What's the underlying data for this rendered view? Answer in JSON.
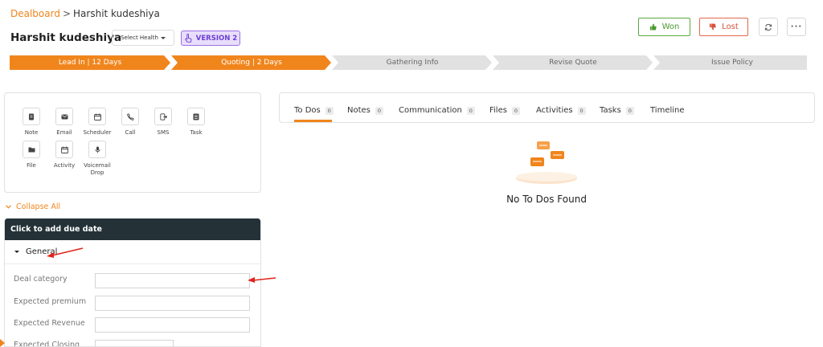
{
  "breadcrumb": {
    "root": "Dealboard",
    "separator": ">",
    "current": "Harshit kudeshiya"
  },
  "header": {
    "title": "Harshit kudeshiya",
    "health_select": "Select Health",
    "version": "VERSION 2",
    "won_label": "Won",
    "lost_label": "Lost"
  },
  "pipeline": {
    "stages": [
      {
        "label": "Lead In | 12 Days",
        "state": "active"
      },
      {
        "label": "Quoting | 2 Days",
        "state": "active"
      },
      {
        "label": "Gathering Info",
        "state": "inactive"
      },
      {
        "label": "Revise Quote",
        "state": "inactive"
      },
      {
        "label": "Issue Policy",
        "state": "inactive"
      }
    ],
    "active_color": "#f0851c",
    "inactive_color": "#e1e1e1"
  },
  "activities": [
    {
      "label": "Note",
      "icon": "note-icon"
    },
    {
      "label": "Email",
      "icon": "email-icon"
    },
    {
      "label": "Scheduler",
      "icon": "calendar-icon"
    },
    {
      "label": "Call",
      "icon": "phone-icon"
    },
    {
      "label": "SMS",
      "icon": "sms-icon"
    },
    {
      "label": "Task",
      "icon": "task-icon"
    },
    {
      "label": "File",
      "icon": "folder-icon"
    },
    {
      "label": "Activity",
      "icon": "calendar-icon"
    },
    {
      "label": "Voicemail Drop",
      "icon": "microphone-icon"
    }
  ],
  "collapse_all": "Collapse All",
  "form": {
    "header": "Click to add due date",
    "section": "General",
    "fields": [
      {
        "label": "Deal category",
        "value": ""
      },
      {
        "label": "Expected premium",
        "value": ""
      },
      {
        "label": "Expected Revenue",
        "value": ""
      },
      {
        "label": "Expected Closing",
        "value": ""
      }
    ]
  },
  "tabs": [
    {
      "label": "To Dos",
      "count": "0",
      "active": true
    },
    {
      "label": "Notes",
      "count": "0"
    },
    {
      "label": "Communication",
      "count": "0"
    },
    {
      "label": "Files",
      "count": "0"
    },
    {
      "label": "Activities",
      "count": "0"
    },
    {
      "label": "Tasks",
      "count": "0"
    },
    {
      "label": "Timeline",
      "count": null
    }
  ],
  "empty_state": "No To Dos Found",
  "colors": {
    "accent": "#f0851c",
    "won": "#4a9a2e",
    "lost": "#d5533a",
    "version_purple": "#6b3fd4",
    "annotation_red": "#e0231c"
  }
}
